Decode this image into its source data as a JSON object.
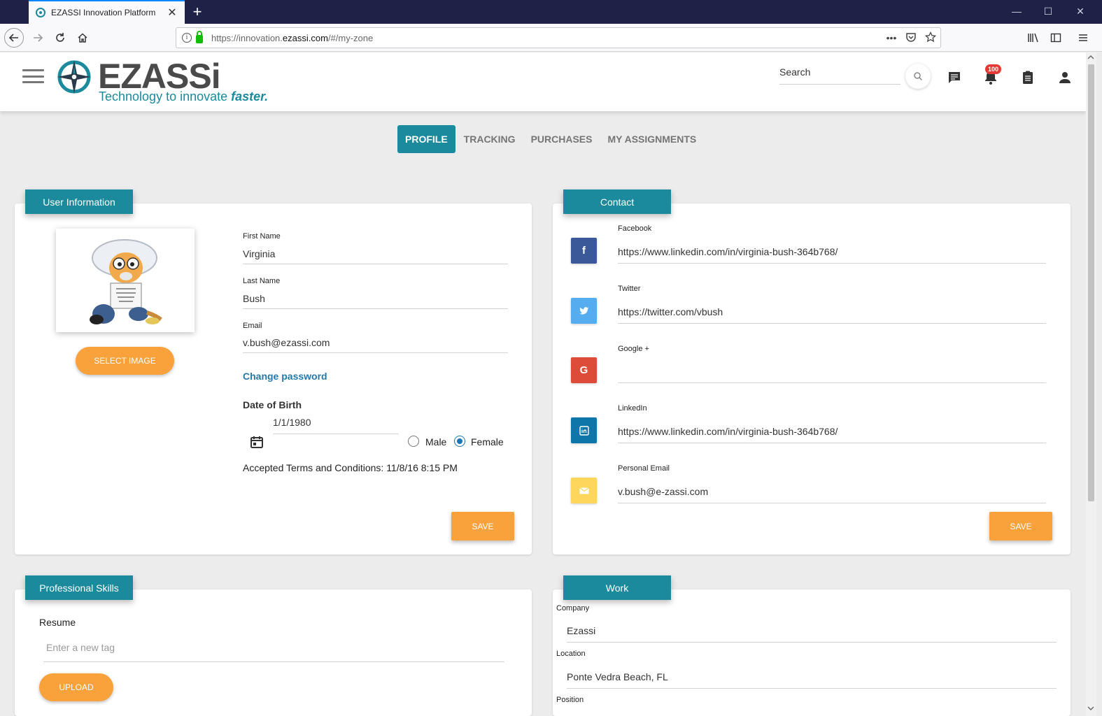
{
  "browser": {
    "tab_title": "EZASSI Innovation Platform",
    "url_prefix": "https://innovation.",
    "url_host": "ezassi.com",
    "url_path": "/#/my-zone"
  },
  "header": {
    "logo_word": "EZASSi",
    "logo_tagline": "Technology to innovate ",
    "logo_tagline_em": "faster.",
    "search_placeholder": "Search",
    "notification_count": "100"
  },
  "tabs": [
    "PROFILE",
    "TRACKING",
    "PURCHASES",
    "MY ASSIGNMENTS"
  ],
  "user_info": {
    "title": "User Information",
    "select_image": "SELECT IMAGE",
    "first_name_label": "First Name",
    "first_name": "Virginia",
    "last_name_label": "Last Name",
    "last_name": "Bush",
    "email_label": "Email",
    "email": "v.bush@ezassi.com",
    "change_password": "Change password",
    "dob_label": "Date of Birth",
    "dob": "1/1/1980",
    "gender_male": "Male",
    "gender_female": "Female",
    "gender_selected": "Female",
    "terms": "Accepted Terms and Conditions: 11/8/16 8:15 PM",
    "save": "SAVE"
  },
  "contact": {
    "title": "Contact",
    "facebook_label": "Facebook",
    "facebook": "https://www.linkedin.com/in/virginia-bush-364b768/",
    "twitter_label": "Twitter",
    "twitter": "https://twitter.com/vbush",
    "google_label": "Google +",
    "google": "",
    "linkedin_label": "LinkedIn",
    "linkedin": "https://www.linkedin.com/in/virginia-bush-364b768/",
    "personal_email_label": "Personal Email",
    "personal_email": "v.bush@e-zassi.com",
    "save": "SAVE",
    "colors": {
      "facebook": "#3b5998",
      "twitter": "#55acee",
      "google": "#dd4b39",
      "linkedin": "#0e76a8",
      "email": "#fdd65b"
    }
  },
  "skills": {
    "title": "Professional Skills",
    "resume_label": "Resume",
    "tag_placeholder": "Enter a new tag",
    "upload": "UPLOAD"
  },
  "work": {
    "title": "Work",
    "company_label": "Company",
    "company": "Ezassi",
    "location_label": "Location",
    "location": "Ponte Vedra Beach, FL",
    "position_label": "Position"
  },
  "theme": {
    "accent": "#1a8a9c",
    "orange": "#f9a13a"
  }
}
